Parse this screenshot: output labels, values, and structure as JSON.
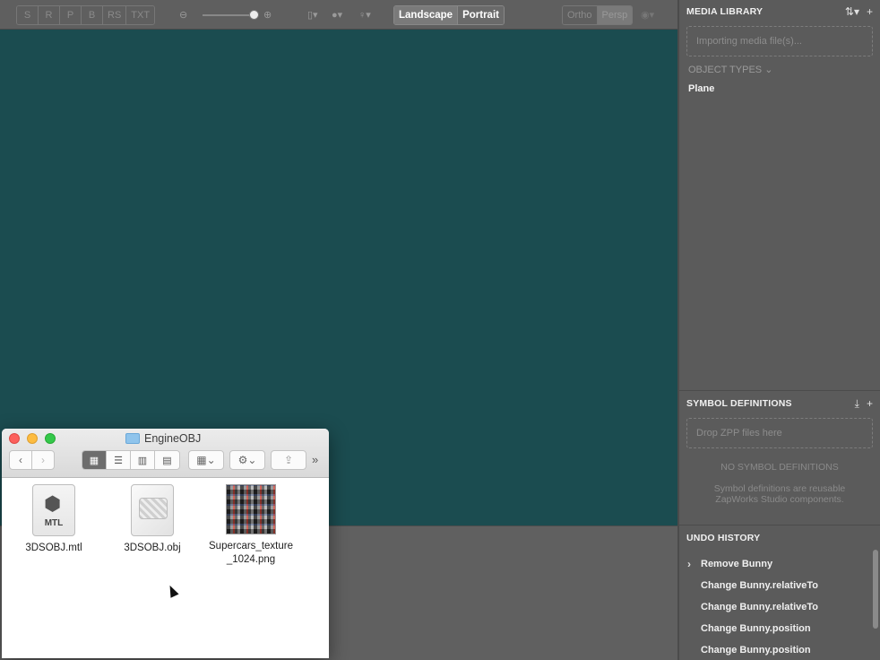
{
  "toolbar": {
    "modes": [
      "S",
      "R",
      "P",
      "B",
      "RS",
      "TXT"
    ],
    "zoom_out_icon": "zoom-out-icon",
    "zoom_in_icon": "zoom-in-icon",
    "orientation": {
      "landscape": "Landscape",
      "portrait": "Portrait",
      "selected": "Landscape"
    },
    "projection": {
      "ortho": "Ortho",
      "persp": "Persp",
      "selected": "Persp"
    }
  },
  "media_library": {
    "title": "MEDIA LIBRARY",
    "importing_text": "Importing media file(s)...",
    "object_types_label": "OBJECT TYPES",
    "object_types": [
      "Plane"
    ]
  },
  "symbol_definitions": {
    "title": "SYMBOL DEFINITIONS",
    "dropzone_text": "Drop ZPP files here",
    "empty_title": "NO SYMBOL DEFINITIONS",
    "empty_desc_line1": "Symbol definitions are reusable",
    "empty_desc_line2": "ZapWorks Studio components."
  },
  "undo_history": {
    "title": "UNDO HISTORY",
    "items": [
      "Remove Bunny",
      "Change Bunny.relativeTo",
      "Change Bunny.relativeTo",
      "Change Bunny.position",
      "Change Bunny.position"
    ]
  },
  "finder": {
    "title": "EngineOBJ",
    "files": [
      {
        "name": "3DSOBJ.mtl",
        "icon_label": "MTL"
      },
      {
        "name": "3DSOBJ.obj"
      },
      {
        "name_line1": "Supercars_texture",
        "name_line2": "_1024.png"
      }
    ]
  },
  "colors": {
    "viewport": "#1b4c50",
    "panel": "#5b5b5b",
    "finder_close": "#fc605c",
    "finder_min": "#fdbc40",
    "finder_max": "#34c84a"
  }
}
